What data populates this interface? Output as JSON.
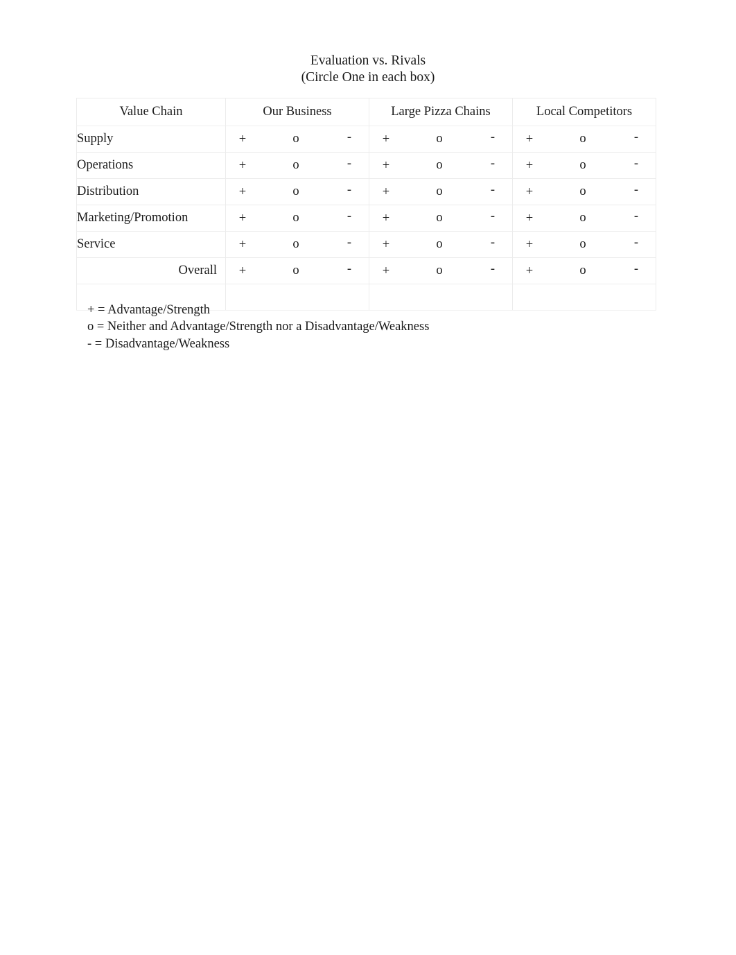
{
  "document": {
    "title_lines": [
      "Evaluation vs. Rivals",
      "(Circle One in each box)"
    ]
  },
  "table": {
    "headers": [
      "Value Chain",
      "Our Business",
      "Large Pizza Chains",
      "Local Competitors"
    ],
    "markers": [
      "+",
      "o",
      "-"
    ],
    "rows": [
      {
        "label": "Supply",
        "align": "left",
        "ratings": [
          [
            "+",
            "o",
            "-"
          ],
          [
            "+",
            "o",
            "-"
          ],
          [
            "+",
            "o",
            "-"
          ]
        ]
      },
      {
        "label": "Operations",
        "align": "left",
        "ratings": [
          [
            "+",
            "o",
            "-"
          ],
          [
            "+",
            "o",
            "-"
          ],
          [
            "+",
            "o",
            "-"
          ]
        ]
      },
      {
        "label": "Distribution",
        "align": "left",
        "ratings": [
          [
            "+",
            "o",
            "-"
          ],
          [
            "+",
            "o",
            "-"
          ],
          [
            "+",
            "o",
            "-"
          ]
        ]
      },
      {
        "label": "Marketing/Promotion",
        "align": "left",
        "ratings": [
          [
            "+",
            "o",
            "-"
          ],
          [
            "+",
            "o",
            "-"
          ],
          [
            "+",
            "o",
            "-"
          ]
        ]
      },
      {
        "label": "Service",
        "align": "left",
        "ratings": [
          [
            "+",
            "o",
            "-"
          ],
          [
            "+",
            "o",
            "-"
          ],
          [
            "+",
            "o",
            "-"
          ]
        ]
      },
      {
        "label": "Overall",
        "align": "right",
        "ratings": [
          [
            "+",
            "o",
            "-"
          ],
          [
            "+",
            "o",
            "-"
          ],
          [
            "+",
            "o",
            "-"
          ]
        ]
      }
    ]
  },
  "legend": {
    "lines": [
      "+ = Advantage/Strength",
      "o = Neither and Advantage/Strength nor a Disadvantage/Weakness",
      "- = Disadvantage/Weakness"
    ]
  },
  "colors": {
    "page_background": "#ffffff",
    "text": "#1a1a1a",
    "table_border": "#ececec"
  }
}
